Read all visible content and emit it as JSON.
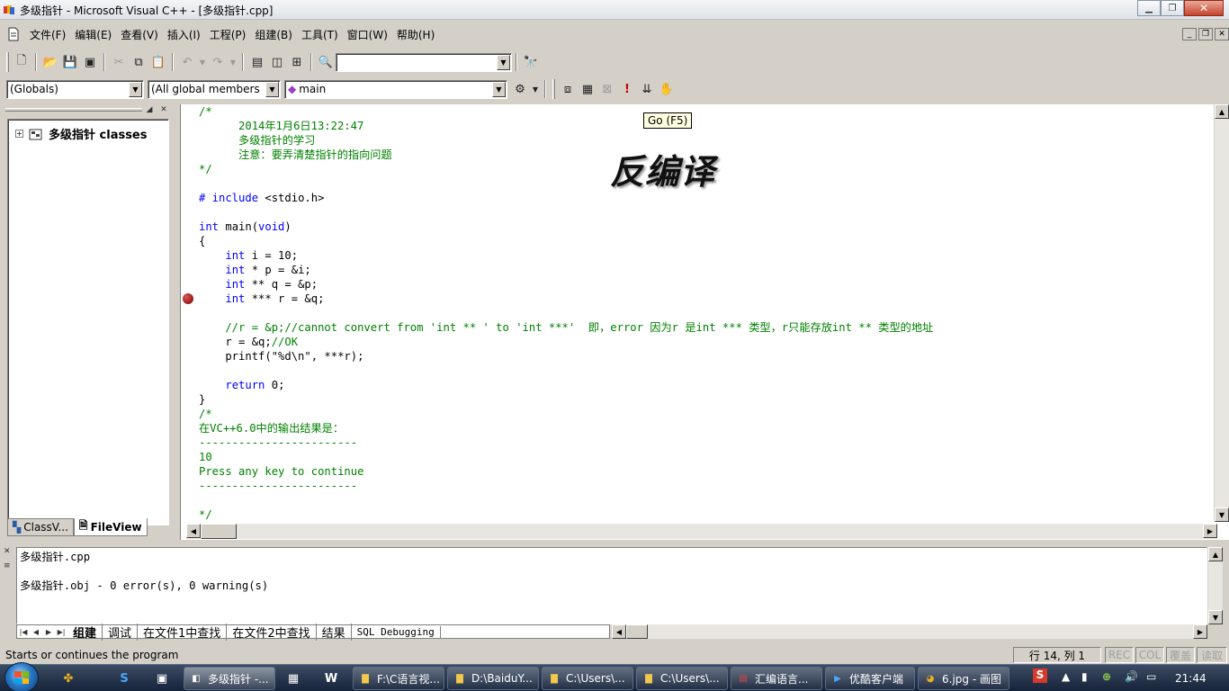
{
  "window": {
    "title": "多级指针 - Microsoft Visual C++ - [多级指针.cpp]"
  },
  "menu": [
    "文件(F)",
    "编辑(E)",
    "查看(V)",
    "插入(I)",
    "工程(P)",
    "组建(B)",
    "工具(T)",
    "窗口(W)",
    "帮助(H)"
  ],
  "wizardbar": {
    "scope": "(Globals)",
    "members": "(All global members",
    "function": "main"
  },
  "workspace": {
    "tree_root": "多级指针 classes",
    "tabs": [
      "ClassV...",
      "FileView"
    ]
  },
  "tooltip": "Go (F5)",
  "watermark": "反编译",
  "code_lines": [
    {
      "t": "/*",
      "c": "cm"
    },
    {
      "t": "      2014年1月6日13:22:47",
      "c": "cm"
    },
    {
      "t": "      多级指针的学习",
      "c": "cm"
    },
    {
      "t": "      注意：要弄清楚指针的指向问题",
      "c": "cm"
    },
    {
      "t": "*/",
      "c": "cm"
    },
    {
      "t": "",
      "c": "tx"
    },
    {
      "t": "# include <stdio.h>",
      "c": "pp"
    },
    {
      "t": "",
      "c": "tx"
    },
    {
      "t": "int main(void)",
      "c": "fn"
    },
    {
      "t": "{",
      "c": "tx"
    },
    {
      "t": "    int i = 10;",
      "c": "decl"
    },
    {
      "t": "    int * p = &i;",
      "c": "decl"
    },
    {
      "t": "    int ** q = &p;",
      "c": "decl"
    },
    {
      "t": "    int *** r = &q;",
      "c": "decl"
    },
    {
      "t": "",
      "c": "tx"
    },
    {
      "t": "    //r = &p;//cannot convert from 'int ** ' to 'int ***'  即，error 因为r 是int *** 类型，r只能存放int ** 类型的地址",
      "c": "cm"
    },
    {
      "t": "    r = &q;//OK",
      "c": "ok"
    },
    {
      "t": "    printf(\"%d\\n\", ***r);",
      "c": "tx"
    },
    {
      "t": "",
      "c": "tx"
    },
    {
      "t": "    return 0;",
      "c": "ret"
    },
    {
      "t": "}",
      "c": "tx"
    },
    {
      "t": "/*",
      "c": "cm"
    },
    {
      "t": "在VC++6.0中的输出结果是：",
      "c": "cm"
    },
    {
      "t": "------------------------",
      "c": "cm"
    },
    {
      "t": "10",
      "c": "cm"
    },
    {
      "t": "Press any key to continue",
      "c": "cm"
    },
    {
      "t": "------------------------",
      "c": "cm"
    },
    {
      "t": "",
      "c": "tx"
    },
    {
      "t": "*/",
      "c": "cm"
    }
  ],
  "breakpoint_line": 13,
  "output": {
    "lines": [
      "多级指针.cpp",
      "",
      "多级指针.obj - 0 error(s), 0 warning(s)"
    ],
    "tabs": [
      "组建",
      "调试",
      "在文件1中查找",
      "在文件2中查找",
      "结果",
      "SQL Debugging"
    ]
  },
  "status": {
    "message": "Starts or continues the program",
    "position": "行 14, 列 1",
    "indicators": [
      "REC",
      "COL",
      "覆盖",
      "读取"
    ]
  },
  "taskbar": {
    "tasks": [
      "多级指针 -...",
      "F:\\C语言视...",
      "D:\\BaiduY...",
      "C:\\Users\\...",
      "C:\\Users\\...",
      "汇编语言...",
      "优酷客户端",
      "6.jpg - 画图"
    ],
    "clock": "21:44"
  }
}
